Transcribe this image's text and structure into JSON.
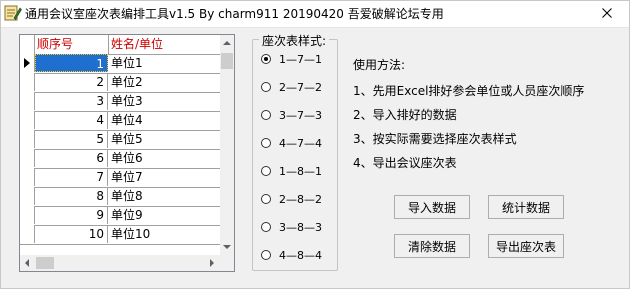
{
  "window": {
    "title": "通用会议室座次表编排工具v1.5 By charm911 20190420 吾爱破解论坛专用",
    "close_glyph": "✕",
    "icon": "pencil-app-icon"
  },
  "grid": {
    "columns": [
      "顺序号",
      "姓名/单位"
    ],
    "rows": [
      {
        "num": "1",
        "name": "单位1"
      },
      {
        "num": "2",
        "name": "单位2"
      },
      {
        "num": "3",
        "name": "单位3"
      },
      {
        "num": "4",
        "name": "单位4"
      },
      {
        "num": "5",
        "name": "单位5"
      },
      {
        "num": "6",
        "name": "单位6"
      },
      {
        "num": "7",
        "name": "单位7"
      },
      {
        "num": "8",
        "name": "单位8"
      },
      {
        "num": "9",
        "name": "单位9"
      },
      {
        "num": "10",
        "name": "单位10"
      }
    ],
    "selected_row": 1,
    "header_color": "#cc0000",
    "selection_color": "#1e6fd0"
  },
  "layout_style": {
    "title": "座次表样式:",
    "options": [
      "1—7—1",
      "2—7—2",
      "3—7—3",
      "4—7—4",
      "1—8—1",
      "2—8—2",
      "3—8—3",
      "4—8—4"
    ],
    "selected": "1—7—1"
  },
  "usage": {
    "heading": "使用方法:",
    "steps": [
      "1、先用Excel排好参会单位或人员座次顺序",
      "2、导入排好的数据",
      "3、按实际需要选择座次表样式",
      "4、导出会议座次表"
    ]
  },
  "buttons": {
    "import": "导入数据",
    "stats": "统计数据",
    "clear": "清除数据",
    "export": "导出座次表"
  }
}
